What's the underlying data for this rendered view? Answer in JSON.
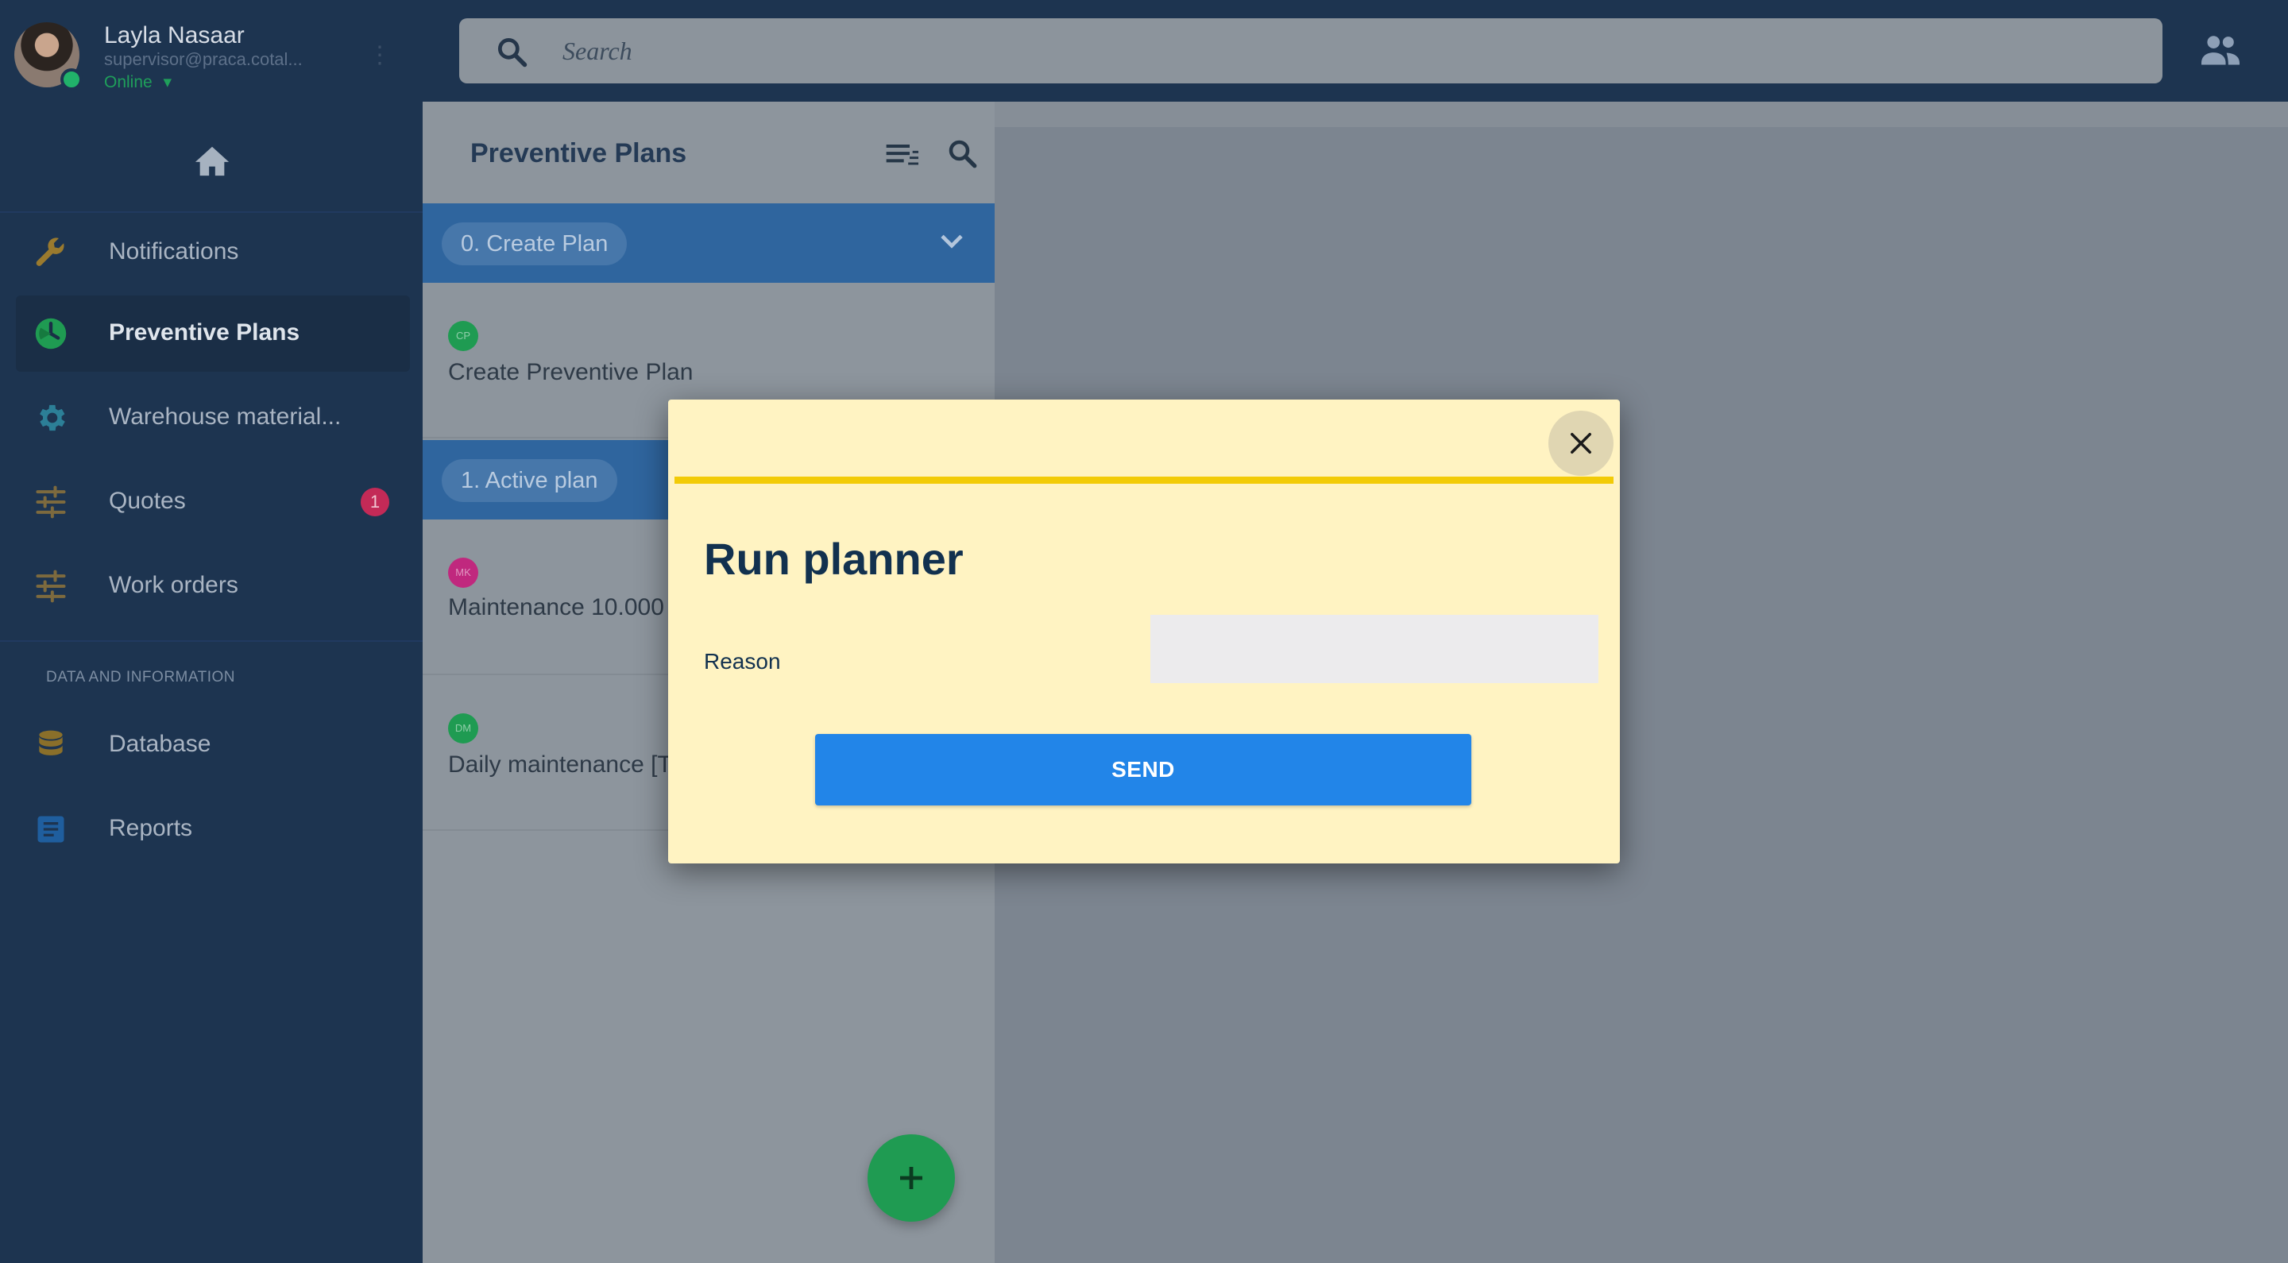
{
  "user": {
    "name": "Layla Nasaar",
    "email": "supervisor@praca.cotal...",
    "status": "Online",
    "status_caret": "▾"
  },
  "search": {
    "placeholder": "Search"
  },
  "sidebar": {
    "items": [
      {
        "label": "Notifications",
        "icon": "wrench-icon"
      },
      {
        "label": "Preventive Plans",
        "icon": "clock-icon",
        "active": true
      },
      {
        "label": "Warehouse material...",
        "icon": "gear-icon"
      },
      {
        "label": "Quotes",
        "icon": "sliders-icon",
        "badge": "1"
      },
      {
        "label": "Work orders",
        "icon": "sliders-icon"
      }
    ],
    "section_title": "DATA AND INFORMATION",
    "section_items": [
      {
        "label": "Database",
        "icon": "database-icon"
      },
      {
        "label": "Reports",
        "icon": "report-icon"
      }
    ]
  },
  "panel": {
    "title": "Preventive Plans",
    "groups": [
      {
        "label": "0. Create Plan"
      },
      {
        "label": "1. Active plan"
      }
    ],
    "rows": [
      {
        "initials": "CP",
        "title": "Create Preventive Plan",
        "color": "#1f9b52"
      },
      {
        "initials": "MK",
        "title": "Maintenance 10.000",
        "color": "#c0287e"
      },
      {
        "initials": "DM",
        "title": "Daily maintenance [T",
        "color": "#1f9b52"
      }
    ]
  },
  "modal": {
    "title": "Run planner",
    "reason_label": "Reason",
    "reason_value": "",
    "send_label": "SEND"
  },
  "colors": {
    "accent": "#2285e8",
    "modal_bg": "#fff3c2",
    "modal_line": "#f2cb07",
    "sidebar_bg": "#1d3450"
  }
}
